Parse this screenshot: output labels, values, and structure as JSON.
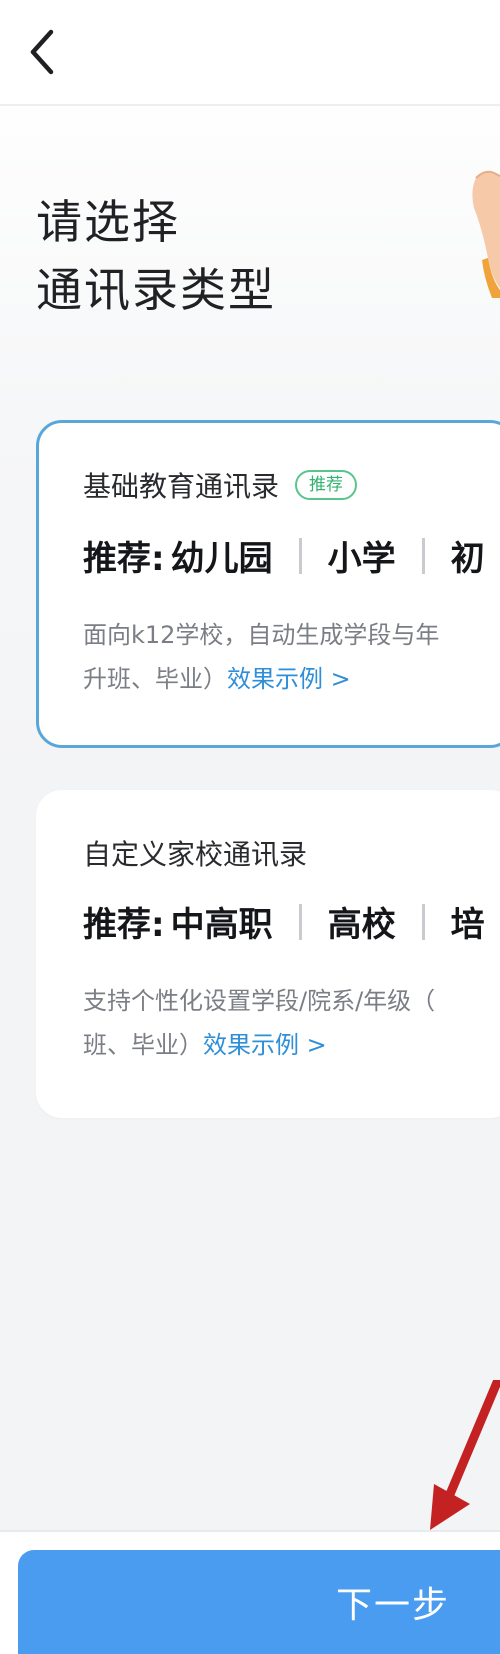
{
  "header": {
    "back_icon": "chevron-left-icon"
  },
  "page": {
    "title_line1": "请选择",
    "title_line2": "通讯录类型"
  },
  "cards": {
    "basic": {
      "title": "基础教育通讯录",
      "badge": "推荐",
      "recommend_label": "推荐:",
      "recommend_items": [
        "幼儿园",
        "小学",
        "初"
      ],
      "desc_line1": "面向k12学校，自动生成学段与年",
      "desc_line2_prefix": "升班、毕业）",
      "example_link": "效果示例 >",
      "selected": true
    },
    "custom": {
      "title": "自定义家校通讯录",
      "recommend_label": "推荐:",
      "recommend_items": [
        "中高职",
        "高校",
        "培"
      ],
      "desc_line1": "支持个性化设置学段/院系/年级（",
      "desc_line2_prefix": "班、毕业）",
      "example_link": "效果示例 >",
      "selected": false
    }
  },
  "footer": {
    "next_label": "下一步"
  },
  "colors": {
    "primary": "#4a9cf0",
    "selected_border": "#5aa6d9",
    "badge_green": "#33b26f",
    "link_blue": "#2e8fd8",
    "annotation_red": "#c42222"
  }
}
